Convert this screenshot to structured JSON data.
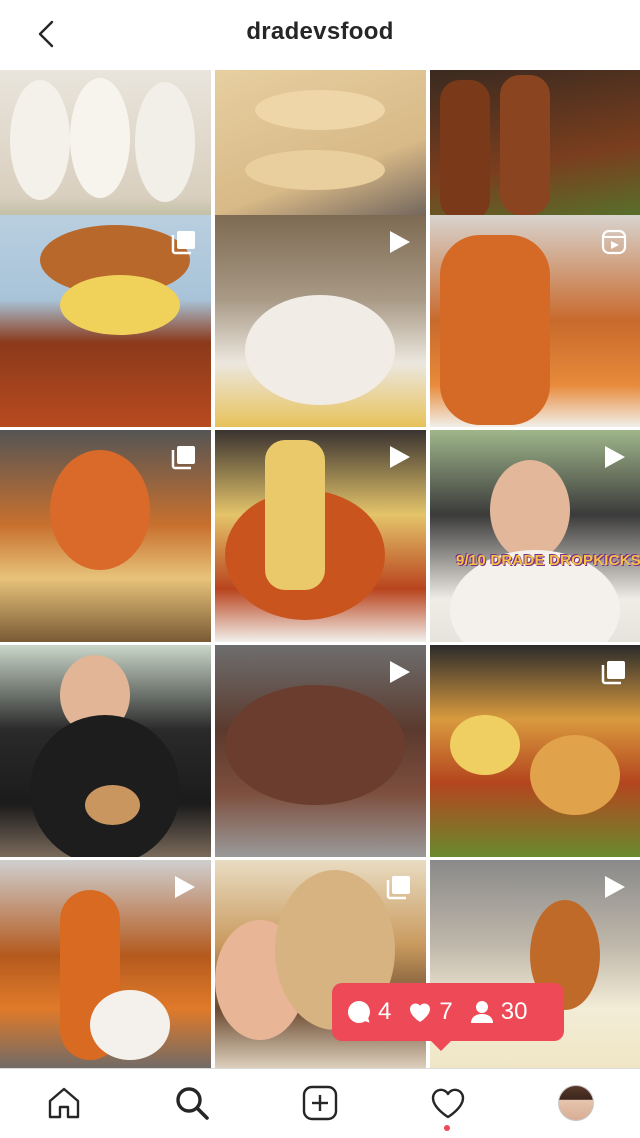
{
  "header": {
    "username": "dradevsfood",
    "back_icon": "chevron-left-icon"
  },
  "grid": {
    "tiles": [
      {
        "alt": "",
        "badge": ""
      },
      {
        "alt": "",
        "badge": ""
      },
      {
        "alt": "",
        "badge": ""
      },
      {
        "alt": "",
        "badge": "carousel-icon"
      },
      {
        "alt": "",
        "badge": "video-icon"
      },
      {
        "alt": "",
        "badge": "reels-icon"
      },
      {
        "alt": "",
        "badge": "carousel-icon"
      },
      {
        "alt": "",
        "badge": "video-icon"
      },
      {
        "alt": "",
        "badge": "video-icon",
        "overlay": "9/10 DRADE DROPKICKS"
      },
      {
        "alt": "",
        "badge": ""
      },
      {
        "alt": "",
        "badge": "video-icon"
      },
      {
        "alt": "",
        "badge": "carousel-icon"
      },
      {
        "alt": "",
        "badge": "video-icon"
      },
      {
        "alt": "",
        "badge": "carousel-icon"
      },
      {
        "alt": "",
        "badge": "video-icon"
      }
    ]
  },
  "activity": {
    "comments": "4",
    "likes": "7",
    "follows": "30",
    "color": "#ed4956"
  },
  "tabbar": {
    "items": [
      "home-icon",
      "search-icon",
      "new-post-icon",
      "activity-heart-icon",
      "profile-avatar"
    ]
  }
}
